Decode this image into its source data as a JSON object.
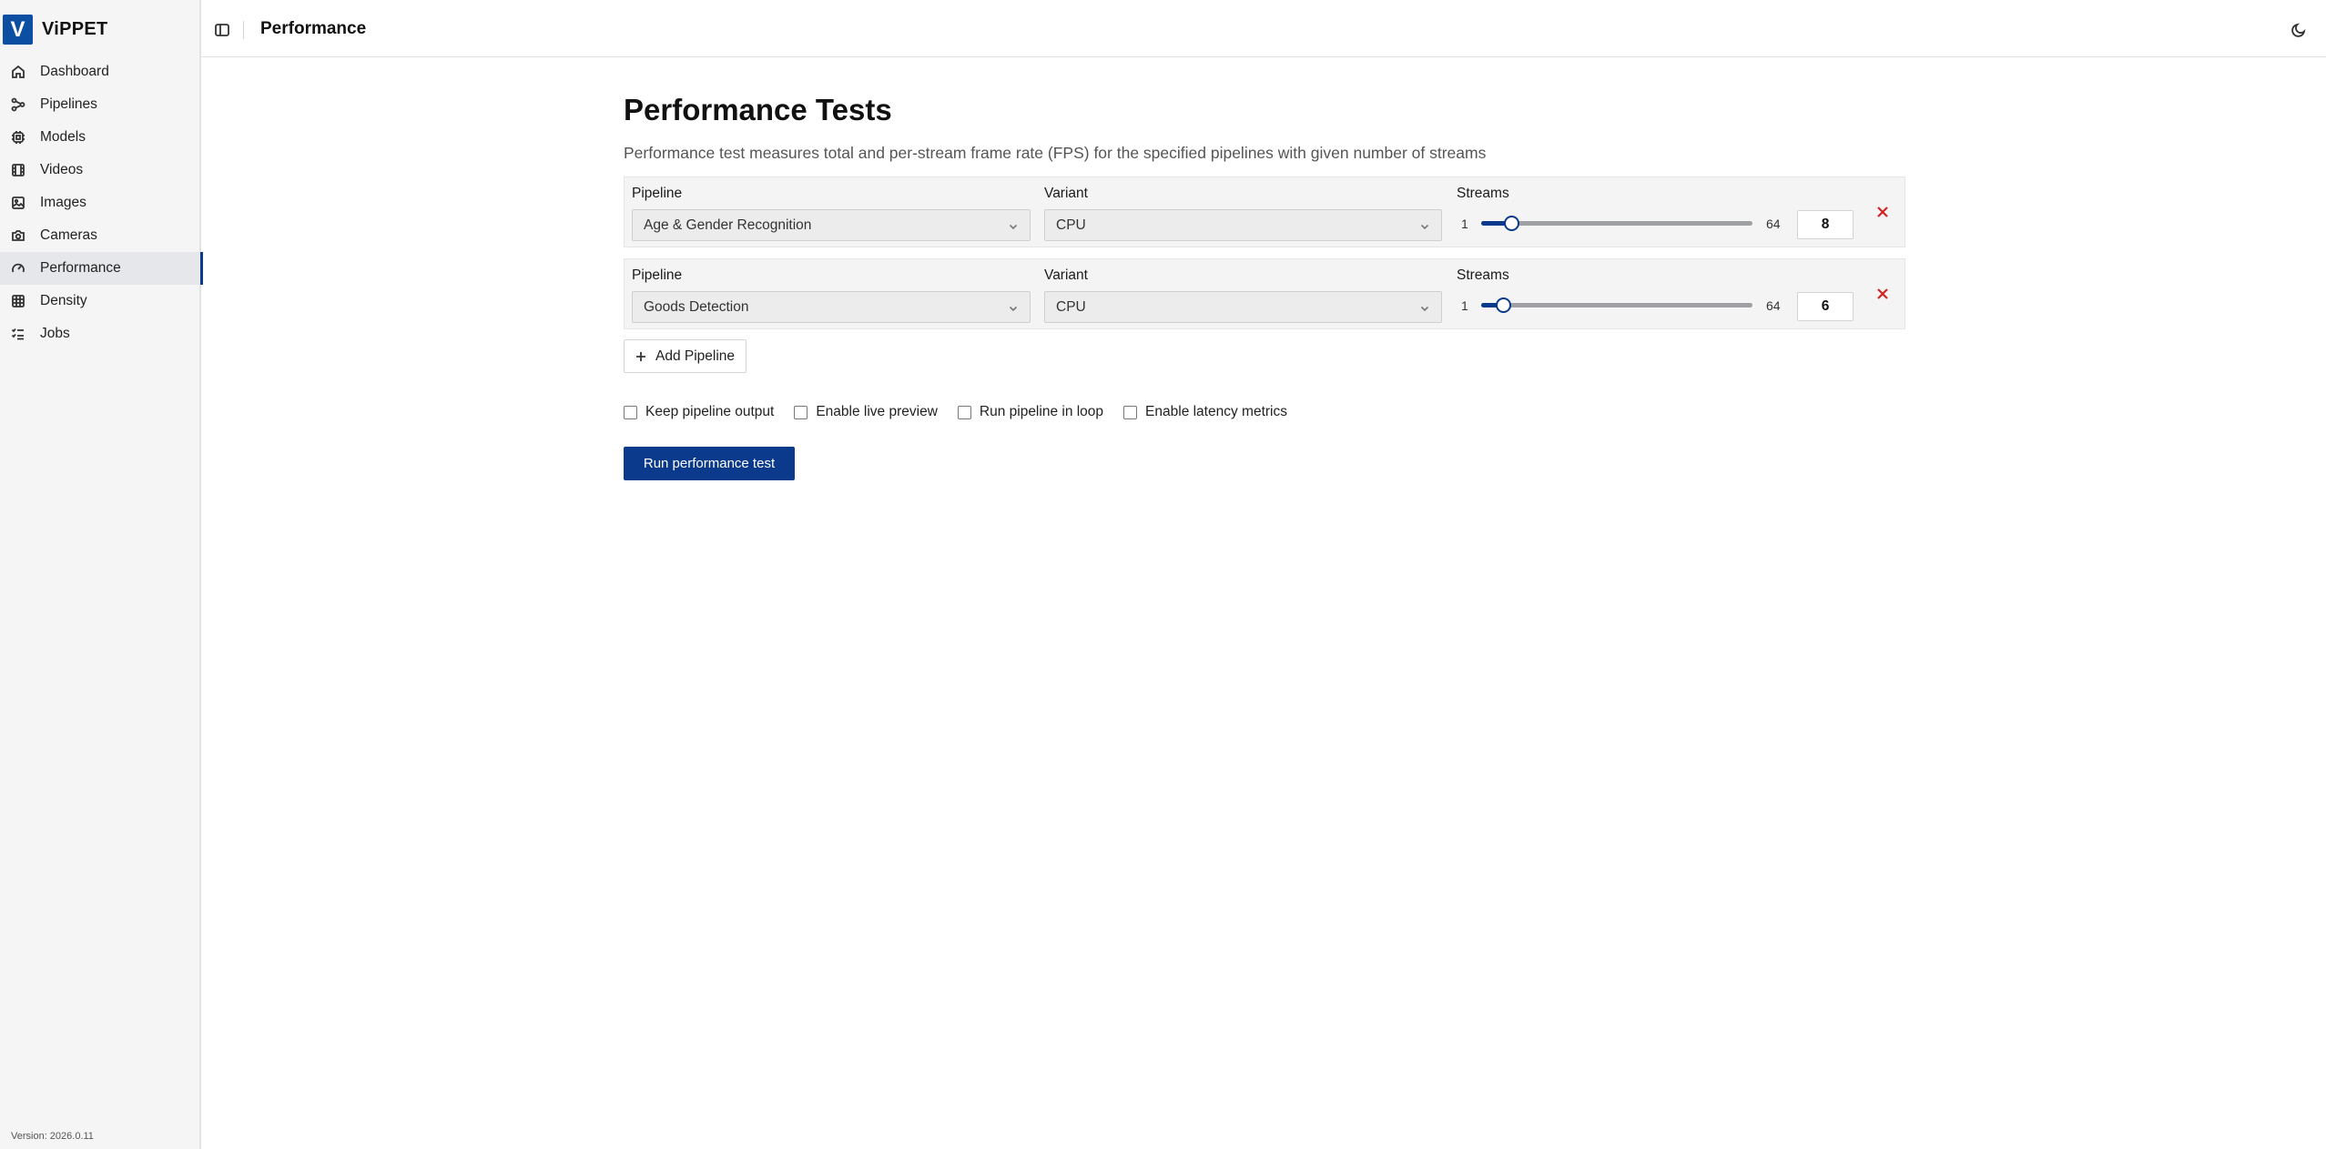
{
  "app": {
    "logo_letter": "V",
    "name": "ViPPET",
    "version": "Version: 2026.0.11"
  },
  "sidebar": {
    "items": [
      {
        "label": "Dashboard",
        "icon": "home-icon"
      },
      {
        "label": "Pipelines",
        "icon": "pipelines-icon"
      },
      {
        "label": "Models",
        "icon": "models-icon"
      },
      {
        "label": "Videos",
        "icon": "film-icon"
      },
      {
        "label": "Images",
        "icon": "image-icon"
      },
      {
        "label": "Cameras",
        "icon": "camera-icon"
      },
      {
        "label": "Performance",
        "icon": "gauge-icon",
        "active": true
      },
      {
        "label": "Density",
        "icon": "grid-icon"
      },
      {
        "label": "Jobs",
        "icon": "list-checks-icon"
      }
    ]
  },
  "header": {
    "title": "Performance"
  },
  "main": {
    "title": "Performance Tests",
    "description": "Performance test measures total and per-stream frame rate (FPS) for the specified pipelines with given number of streams",
    "pipelines": [
      {
        "pipeline_label": "Pipeline",
        "pipeline_value": "Age & Gender Recognition",
        "variant_label": "Variant",
        "variant_value": "CPU",
        "streams_label": "Streams",
        "min": "1",
        "max": "64",
        "streams": "8"
      },
      {
        "pipeline_label": "Pipeline",
        "pipeline_value": "Goods Detection",
        "variant_label": "Variant",
        "variant_value": "CPU",
        "streams_label": "Streams",
        "min": "1",
        "max": "64",
        "streams": "6"
      }
    ],
    "add_pipeline_label": "Add Pipeline",
    "options": [
      {
        "label": "Keep pipeline output",
        "checked": false
      },
      {
        "label": "Enable live preview",
        "checked": false
      },
      {
        "label": "Run pipeline in loop",
        "checked": false
      },
      {
        "label": "Enable latency metrics",
        "checked": false
      }
    ],
    "run_button_label": "Run performance test"
  },
  "colors": {
    "accent": "#0b3a8c",
    "logo": "#0b4ea2",
    "remove": "#d32222"
  }
}
